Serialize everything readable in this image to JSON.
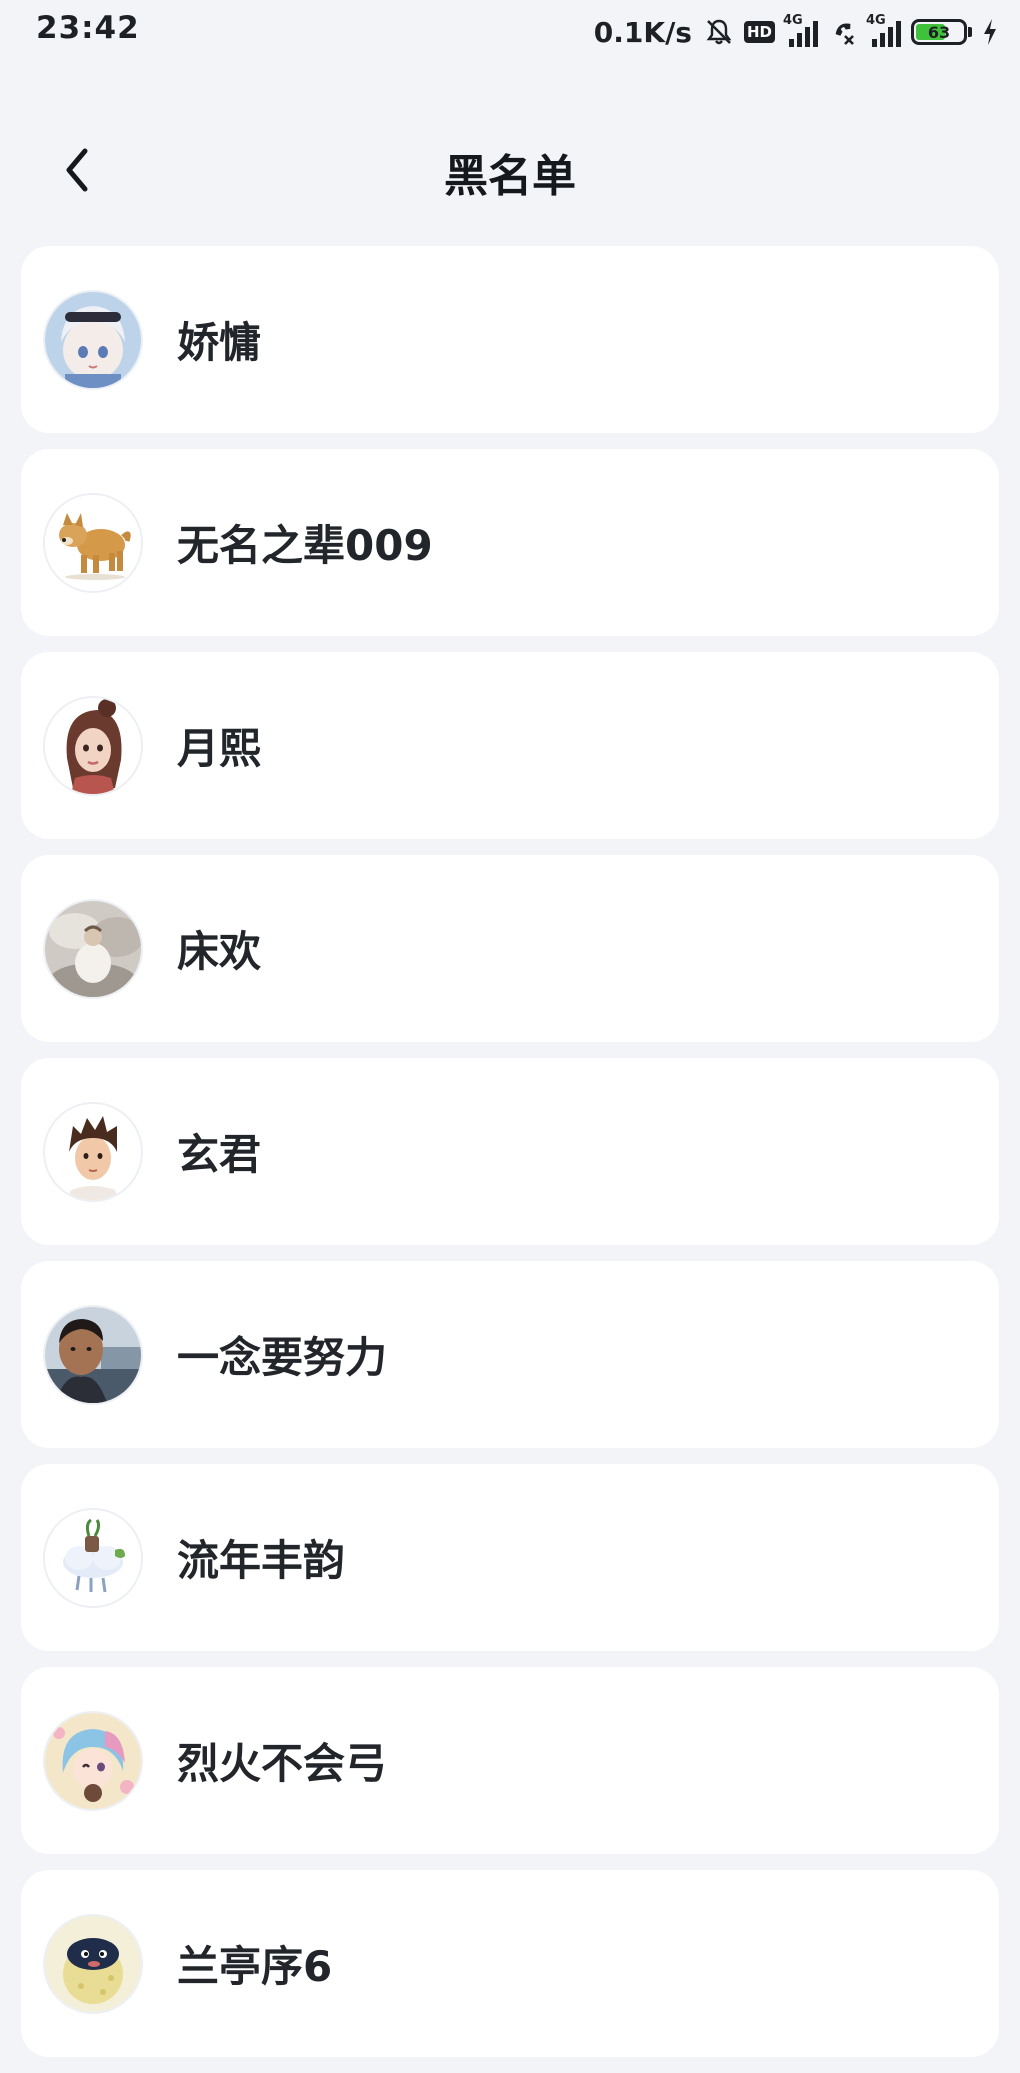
{
  "status_bar": {
    "time": "23:42",
    "net_speed": "0.1K/s",
    "hd_label": "HD",
    "signal1_label": "4G",
    "signal2_label": "4G",
    "battery_percent": "63",
    "battery_level": 0.63
  },
  "header": {
    "title": "黑名单",
    "back_icon": "chevron-left-icon"
  },
  "blacklist": [
    {
      "name": "娇慵"
    },
    {
      "name": "无名之辈009"
    },
    {
      "name": "月熙"
    },
    {
      "name": "床欢"
    },
    {
      "name": "玄君"
    },
    {
      "name": "一念要努力"
    },
    {
      "name": "流年丰韵"
    },
    {
      "name": "烈火不会弓"
    },
    {
      "name": "兰亭序6"
    }
  ]
}
